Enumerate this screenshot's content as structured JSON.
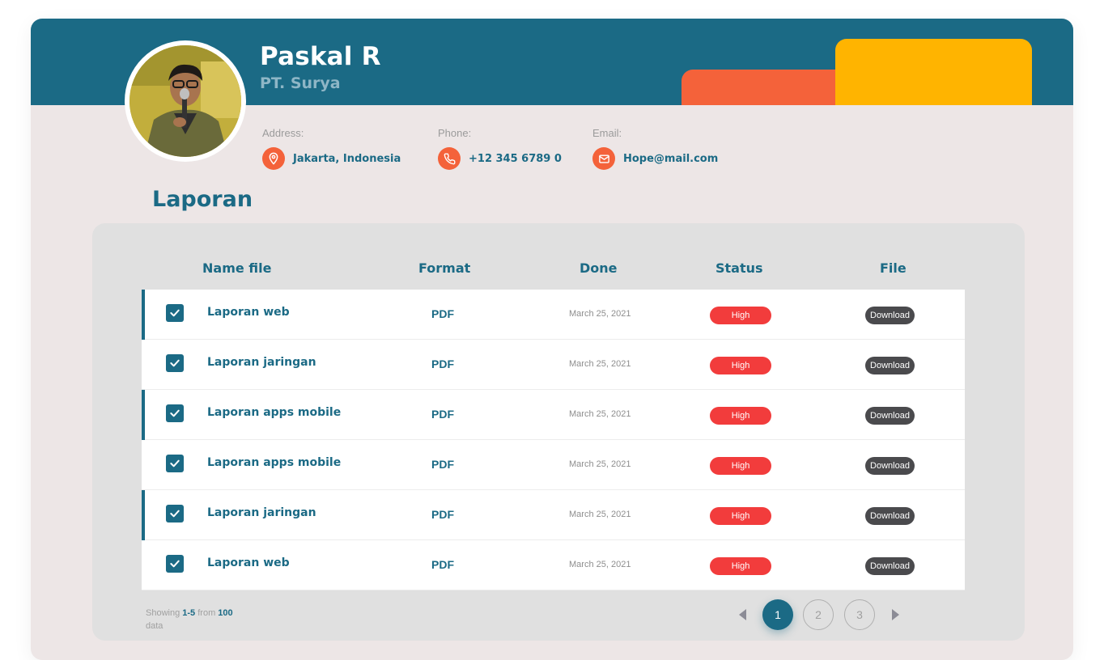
{
  "profile": {
    "name": "Paskal R",
    "company": "PT. Surya",
    "address_label": "Address:",
    "address": "Jakarta, Indonesia",
    "phone_label": "Phone:",
    "phone": "+12 345 6789 0",
    "email_label": "Email:",
    "email": "Hope@mail.com"
  },
  "section_title": "Laporan",
  "table": {
    "headers": {
      "name": "Name file",
      "format": "Format",
      "done": "Done",
      "status": "Status",
      "file": "File"
    },
    "rows": [
      {
        "name": "Laporan web",
        "format": "PDF",
        "done": "March 25, 2021",
        "status": "High",
        "file": "Download",
        "checked": true
      },
      {
        "name": "Laporan  jaringan",
        "format": "PDF",
        "done": "March 25, 2021",
        "status": "High",
        "file": "Download",
        "checked": true
      },
      {
        "name": "Laporan  apps mobile",
        "format": "PDF",
        "done": "March 25, 2021",
        "status": "High",
        "file": "Download",
        "checked": true
      },
      {
        "name": "Laporan apps mobile",
        "format": "PDF",
        "done": "March 25, 2021",
        "status": "High",
        "file": "Download",
        "checked": true
      },
      {
        "name": "Laporan  jaringan",
        "format": "PDF",
        "done": "March 25, 2021",
        "status": "High",
        "file": "Download",
        "checked": true
      },
      {
        "name": "Laporan web",
        "format": "PDF",
        "done": "March 25, 2021",
        "status": "High",
        "file": "Download",
        "checked": true
      }
    ]
  },
  "footer": {
    "showing_prefix": "Showing",
    "showing_range": "1-5",
    "showing_from": "from",
    "showing_total": "100",
    "showing_suffix": "data"
  },
  "pagination": {
    "pages": [
      "1",
      "2",
      "3"
    ],
    "current": "1"
  },
  "colors": {
    "primary": "#1b6a85",
    "accent_orange": "#f4623a",
    "accent_yellow": "#ffb400",
    "status_high": "#f23c3c",
    "download": "#4a4a4d"
  },
  "icons": {
    "address": "map-pin-icon",
    "phone": "phone-icon",
    "email": "mail-icon",
    "checkbox": "checkbox-checked-icon",
    "prev": "caret-left-icon",
    "next": "caret-right-icon"
  }
}
